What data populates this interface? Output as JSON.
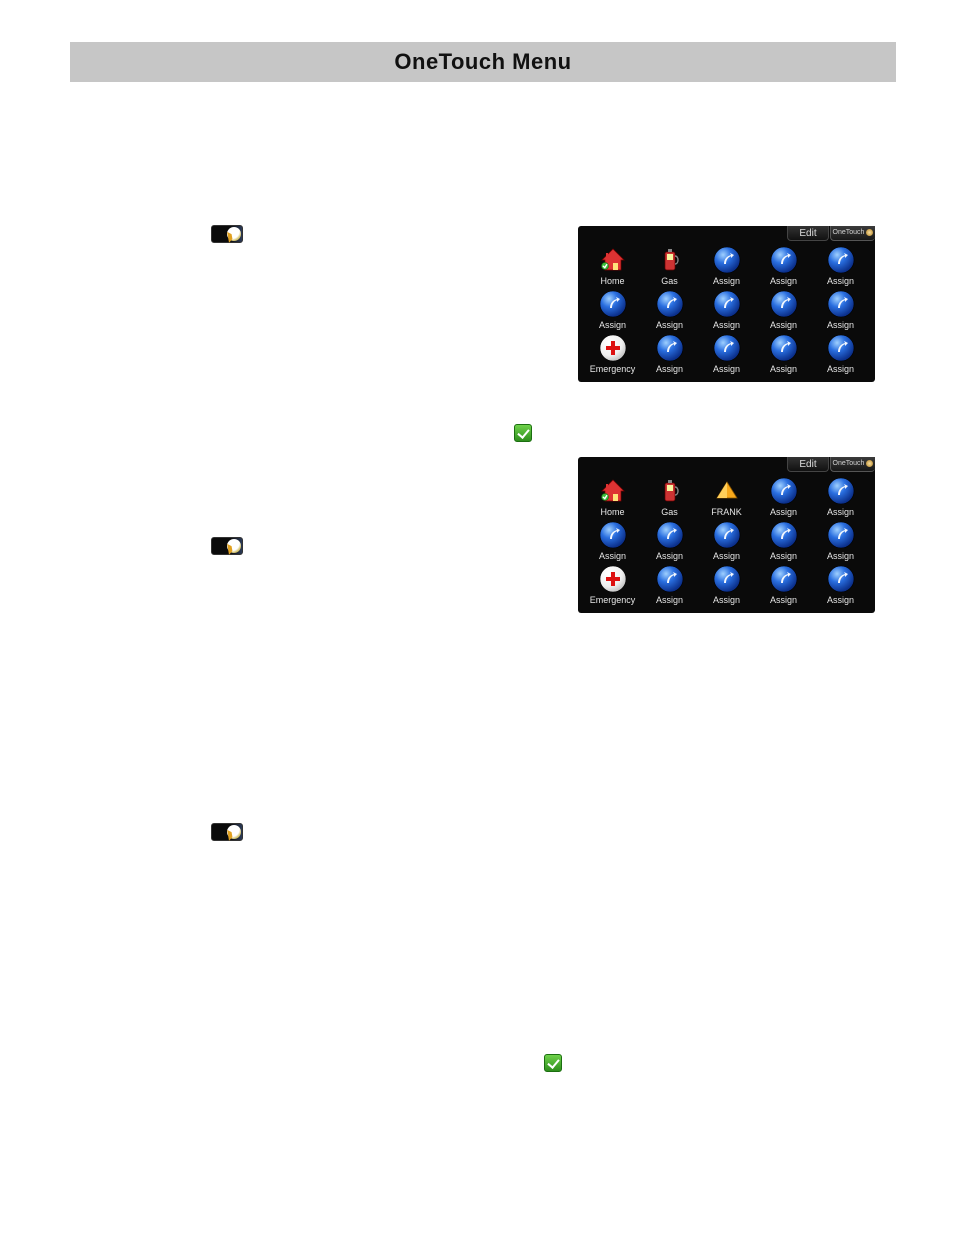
{
  "header": {
    "title": "OneTouch Menu"
  },
  "icons": {
    "onetouch_small": "onetouch-icon",
    "check": "check-icon"
  },
  "device1": {
    "tabs": {
      "edit": "Edit",
      "onetouch": "OneTouch"
    },
    "cells": [
      {
        "type": "home",
        "label": "Home"
      },
      {
        "type": "gas",
        "label": "Gas"
      },
      {
        "type": "assign",
        "label": "Assign"
      },
      {
        "type": "assign",
        "label": "Assign"
      },
      {
        "type": "assign",
        "label": "Assign"
      },
      {
        "type": "assign",
        "label": "Assign"
      },
      {
        "type": "assign",
        "label": "Assign"
      },
      {
        "type": "assign",
        "label": "Assign"
      },
      {
        "type": "assign",
        "label": "Assign"
      },
      {
        "type": "assign",
        "label": "Assign"
      },
      {
        "type": "emerg",
        "label": "Emergency"
      },
      {
        "type": "assign",
        "label": "Assign"
      },
      {
        "type": "assign",
        "label": "Assign"
      },
      {
        "type": "assign",
        "label": "Assign"
      },
      {
        "type": "assign",
        "label": "Assign"
      }
    ]
  },
  "device2": {
    "tabs": {
      "edit": "Edit",
      "onetouch": "OneTouch"
    },
    "cells": [
      {
        "type": "home",
        "label": "Home"
      },
      {
        "type": "gas",
        "label": "Gas"
      },
      {
        "type": "frank",
        "label": "FRANK"
      },
      {
        "type": "assign",
        "label": "Assign"
      },
      {
        "type": "assign",
        "label": "Assign"
      },
      {
        "type": "assign",
        "label": "Assign"
      },
      {
        "type": "assign",
        "label": "Assign"
      },
      {
        "type": "assign",
        "label": "Assign"
      },
      {
        "type": "assign",
        "label": "Assign"
      },
      {
        "type": "assign",
        "label": "Assign"
      },
      {
        "type": "emerg",
        "label": "Emergency"
      },
      {
        "type": "assign",
        "label": "Assign"
      },
      {
        "type": "assign",
        "label": "Assign"
      },
      {
        "type": "assign",
        "label": "Assign"
      },
      {
        "type": "assign",
        "label": "Assign"
      }
    ]
  }
}
